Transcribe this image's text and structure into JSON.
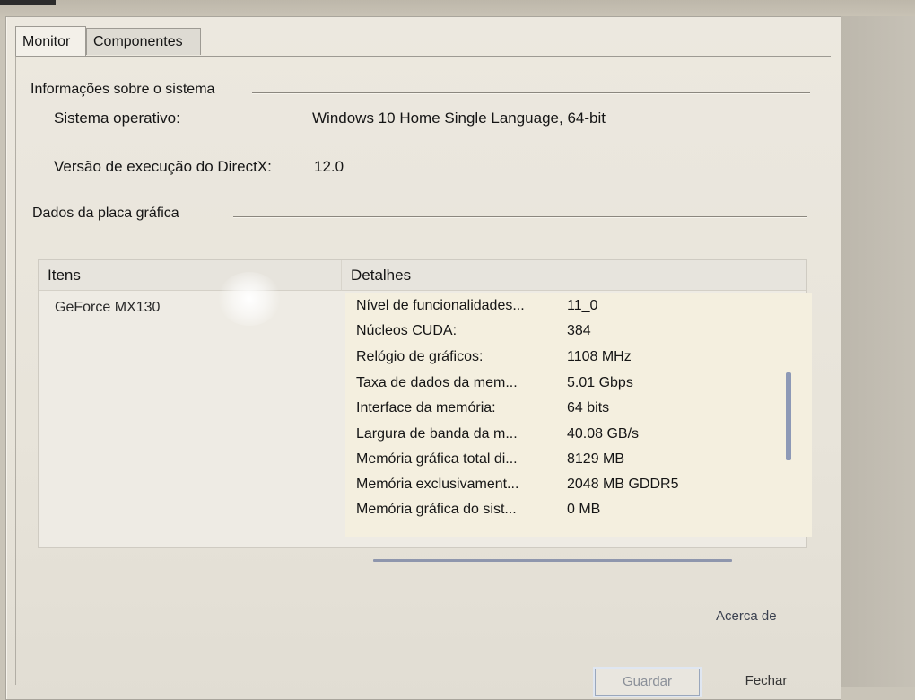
{
  "tabs": [
    {
      "label": "Monitor",
      "active": true
    },
    {
      "label": "Componentes",
      "active": false
    }
  ],
  "system_info": {
    "title": "Informações sobre o sistema",
    "rows": [
      {
        "label": "Sistema operativo:",
        "value": "Windows 10 Home Single Language, 64-bit"
      },
      {
        "label": "Versão de execução do DirectX:",
        "value": "12.0"
      }
    ]
  },
  "gpu": {
    "title": "Dados da placa gráfica",
    "columns": {
      "items": "Itens",
      "details": "Detalhes"
    },
    "items": [
      "GeForce MX130"
    ],
    "details": [
      {
        "key": "Nível de funcionalidades...",
        "value": "11_0"
      },
      {
        "key": "Núcleos CUDA:",
        "value": "384"
      },
      {
        "key": "Relógio de gráficos:",
        "value": "1108 MHz"
      },
      {
        "key": "Taxa de dados da mem...",
        "value": "5.01 Gbps"
      },
      {
        "key": "Interface da memória:",
        "value": "64 bits"
      },
      {
        "key": "Largura de banda da m...",
        "value": "40.08 GB/s"
      },
      {
        "key": "Memória gráfica total di...",
        "value": "8129 MB"
      },
      {
        "key": "Memória exclusivament...",
        "value": "2048 MB GDDR5"
      },
      {
        "key": "Memória gráfica do sist...",
        "value": "0 MB"
      }
    ]
  },
  "footer": {
    "about_label": "Acerca de",
    "save_label": "Guardar",
    "close_label": "Fechar"
  }
}
